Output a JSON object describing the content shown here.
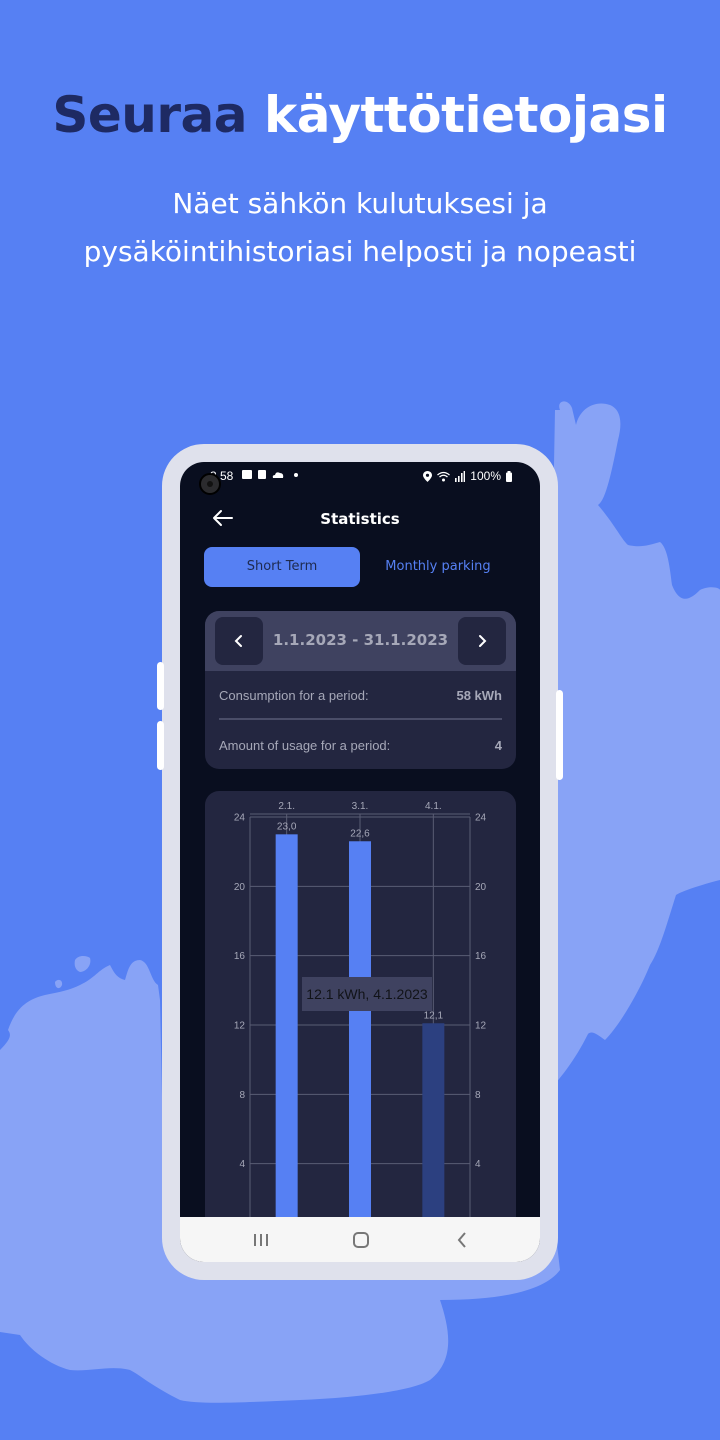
{
  "promo": {
    "headline_part1": "Seuraa",
    "headline_part2": "käyttötietojasi",
    "subtitle_line1": "Näet sähkön kulutuksesi ja",
    "subtitle_line2": "pysäköintihistoriasi helposti ja nopeasti"
  },
  "colors": {
    "background": "#5680F3",
    "map": "#88A3F6",
    "phone_frame": "#DFE1EC",
    "screen_bg": "#090E1F",
    "card_bg": "#232640",
    "card_header_bg": "#3F4260",
    "accent": "#5680F3",
    "bar_selected": "#2C4080"
  },
  "status_bar": {
    "time": "3.58",
    "left_icons": [
      "gallery-icon",
      "calendar-icon",
      "cloud-icon",
      "dot-icon"
    ],
    "right_icons": [
      "location-icon",
      "wifi-icon",
      "signal-icon"
    ],
    "battery": "100%"
  },
  "header": {
    "title": "Statistics",
    "back_icon": "arrow-left-icon"
  },
  "tabs": [
    {
      "label": "Short Term",
      "active": true
    },
    {
      "label": "Monthly parking",
      "active": false
    }
  ],
  "period": {
    "range": "1.1.2023 - 31.1.2023",
    "prev_icon": "chevron-left-icon",
    "next_icon": "chevron-right-icon",
    "rows": [
      {
        "label": "Consumption for a period:",
        "value": "58 kWh"
      },
      {
        "label": "Amount of usage for a period:",
        "value": "4"
      }
    ]
  },
  "chart_data": {
    "type": "bar",
    "categories": [
      "2.1.",
      "3.1.",
      "4.1."
    ],
    "values": [
      23.0,
      22.6,
      12.1
    ],
    "value_labels": [
      "23,0",
      "22,6",
      "12,1"
    ],
    "selected_index": 2,
    "ylim": [
      0,
      24
    ],
    "yticks": [
      4,
      8,
      12,
      16,
      20,
      24
    ],
    "ytick_labels": [
      "4",
      "8",
      "12",
      "16",
      "20",
      "24"
    ],
    "dual_y_axis": true,
    "xaxis_position": "top",
    "grid": true,
    "tooltip": "12.1 kWh, 4.1.2023",
    "unit": "kWh"
  },
  "navbar": {
    "recents_icon": "recents-icon",
    "home_icon": "home-icon",
    "back_icon": "back-icon"
  }
}
